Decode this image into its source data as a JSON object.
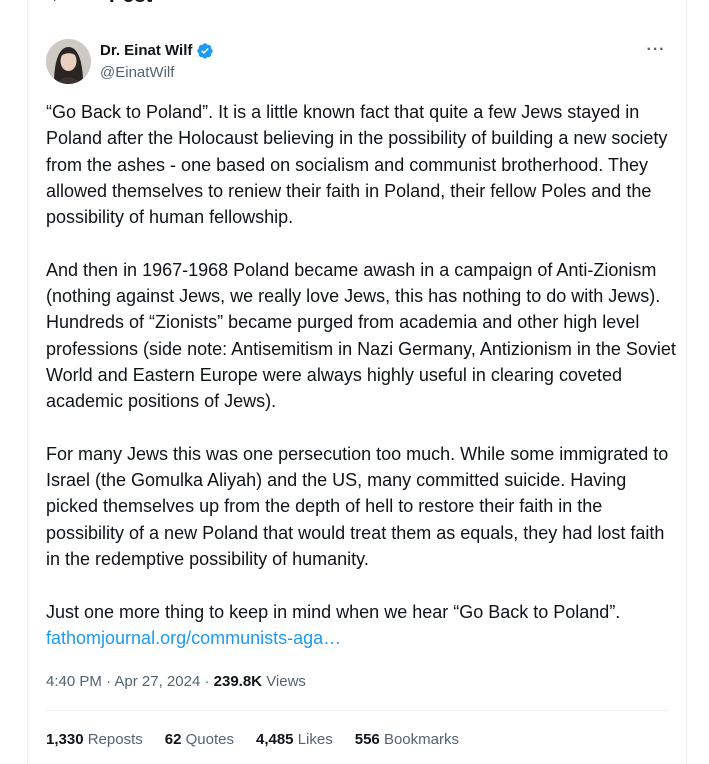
{
  "header": {
    "title": "Post"
  },
  "author": {
    "name": "Dr. Einat Wilf",
    "handle": "@EinatWilf",
    "verified": true,
    "verified_color": "#1d9bf0"
  },
  "tweet": {
    "paragraphs": [
      "“Go Back to Poland”. It is a little known fact that quite a few Jews stayed in Poland after the Holocaust believing in the possibility of building a new society from the ashes - one based on socialism and communist brotherhood. They allowed themselves to reniew their faith in Poland, their fellow Poles and the possibility of human fellowship.",
      "And then in 1967-1968 Poland became awash in a campaign of Anti-Zionism (nothing against Jews, we really love Jews, this has nothing to do with Jews). Hundreds of “Zionists” became purged from academia and other high level professions (side note: Antisemitism in Nazi Germany, Antizionism in the Soviet World and Eastern Europe were always highly useful in clearing coveted academic positions of Jews).",
      "For many Jews this was one persecution too much. While some immigrated to Israel (the Gomulka Aliyah) and the US, many committed suicide. Having picked themselves up from the depth of hell to restore their faith in the possibility of a new Poland that would treat them as equals, they had lost faith in the redemptive possibility of humanity."
    ],
    "closing": "Just one more thing to keep in mind when we hear “Go Back to Poland”.",
    "link_text": "fathomjournal.org/communists-aga…",
    "link_color": "#1d9bf0"
  },
  "meta": {
    "time": "4:40 PM",
    "separator": "·",
    "date": "Apr 27, 2024",
    "views_count": "239.8K",
    "views_label": "Views"
  },
  "stats": {
    "reposts_count": "1,330",
    "reposts_label": "Reposts",
    "quotes_count": "62",
    "quotes_label": "Quotes",
    "likes_count": "4,485",
    "likes_label": "Likes",
    "bookmarks_count": "556",
    "bookmarks_label": "Bookmarks"
  },
  "icons": {
    "back": "arrow-left-icon",
    "verified": "verified-badge-icon",
    "more": "more-options-icon"
  }
}
